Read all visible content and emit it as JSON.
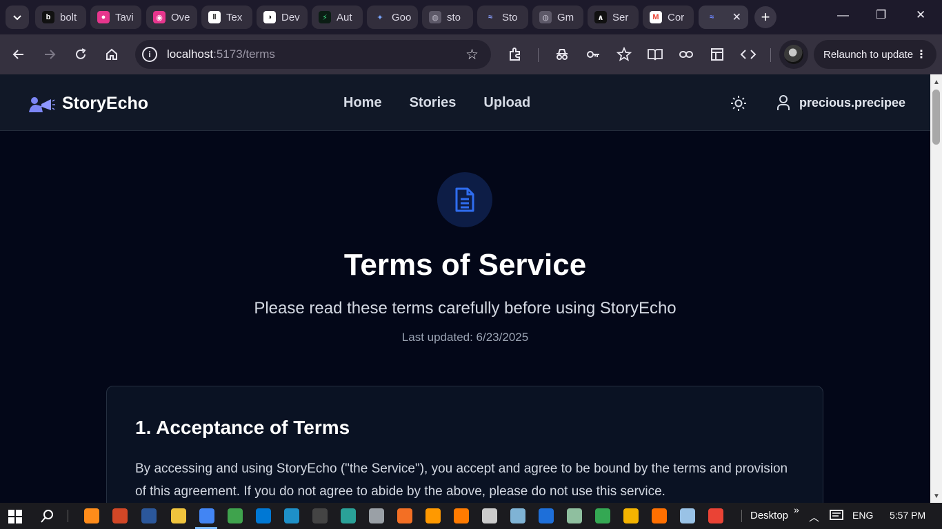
{
  "browser": {
    "tabs": [
      {
        "title": "bolt",
        "color": "#ffffff",
        "bg": "#111111",
        "glyph": "b"
      },
      {
        "title": "Tavi",
        "color": "#ffffff",
        "bg": "#e7368d",
        "glyph": "●"
      },
      {
        "title": "Ove",
        "color": "#ffffff",
        "bg": "#e7368d",
        "glyph": "◉"
      },
      {
        "title": "Tex",
        "color": "#111111",
        "bg": "#ffffff",
        "glyph": "‖"
      },
      {
        "title": "Dev",
        "color": "#111111",
        "bg": "#ffffff",
        "glyph": "◑"
      },
      {
        "title": "Aut",
        "color": "#3ddc84",
        "bg": "#0b1d14",
        "glyph": "⚡"
      },
      {
        "title": "Goo",
        "color": "#7aa7ff",
        "bg": "#322e3c",
        "glyph": "✦"
      },
      {
        "title": "sto",
        "color": "#b9b5c3",
        "bg": "#5d5968",
        "glyph": "◍"
      },
      {
        "title": "Sto",
        "color": "#8aa0ff",
        "bg": "#322e3c",
        "glyph": "≈"
      },
      {
        "title": "Gm",
        "color": "#b9b5c3",
        "bg": "#5d5968",
        "glyph": "◍"
      },
      {
        "title": "Ser",
        "color": "#ffffff",
        "bg": "#111111",
        "glyph": "∧"
      },
      {
        "title": "Cor",
        "color": "#ea4335",
        "bg": "#ffffff",
        "glyph": "M"
      }
    ],
    "active_tab_glyph": "≈",
    "url_host": "localhost",
    "url_path": ":5173/terms",
    "relaunch_label": "Relaunch to update"
  },
  "site": {
    "brand": "StoryEcho",
    "nav": [
      "Home",
      "Stories",
      "Upload"
    ],
    "username": "precious.precipee"
  },
  "page": {
    "title": "Terms of Service",
    "subtitle": "Please read these terms carefully before using StoryEcho",
    "updated": "Last updated: 6/23/2025",
    "section_heading": "1. Acceptance of Terms",
    "section_body": "By accessing and using StoryEcho (\"the Service\"), you accept and agree to be bound by the terms and provision of this agreement. If you do not agree to abide by the above, please do not use this service."
  },
  "taskbar": {
    "desktop_label": "Desktop",
    "language": "ENG",
    "time": "5:57 PM",
    "chevron": "»"
  },
  "colors": {
    "accent": "#2563eb",
    "page_bg": "#030718",
    "header_bg": "#111827"
  }
}
